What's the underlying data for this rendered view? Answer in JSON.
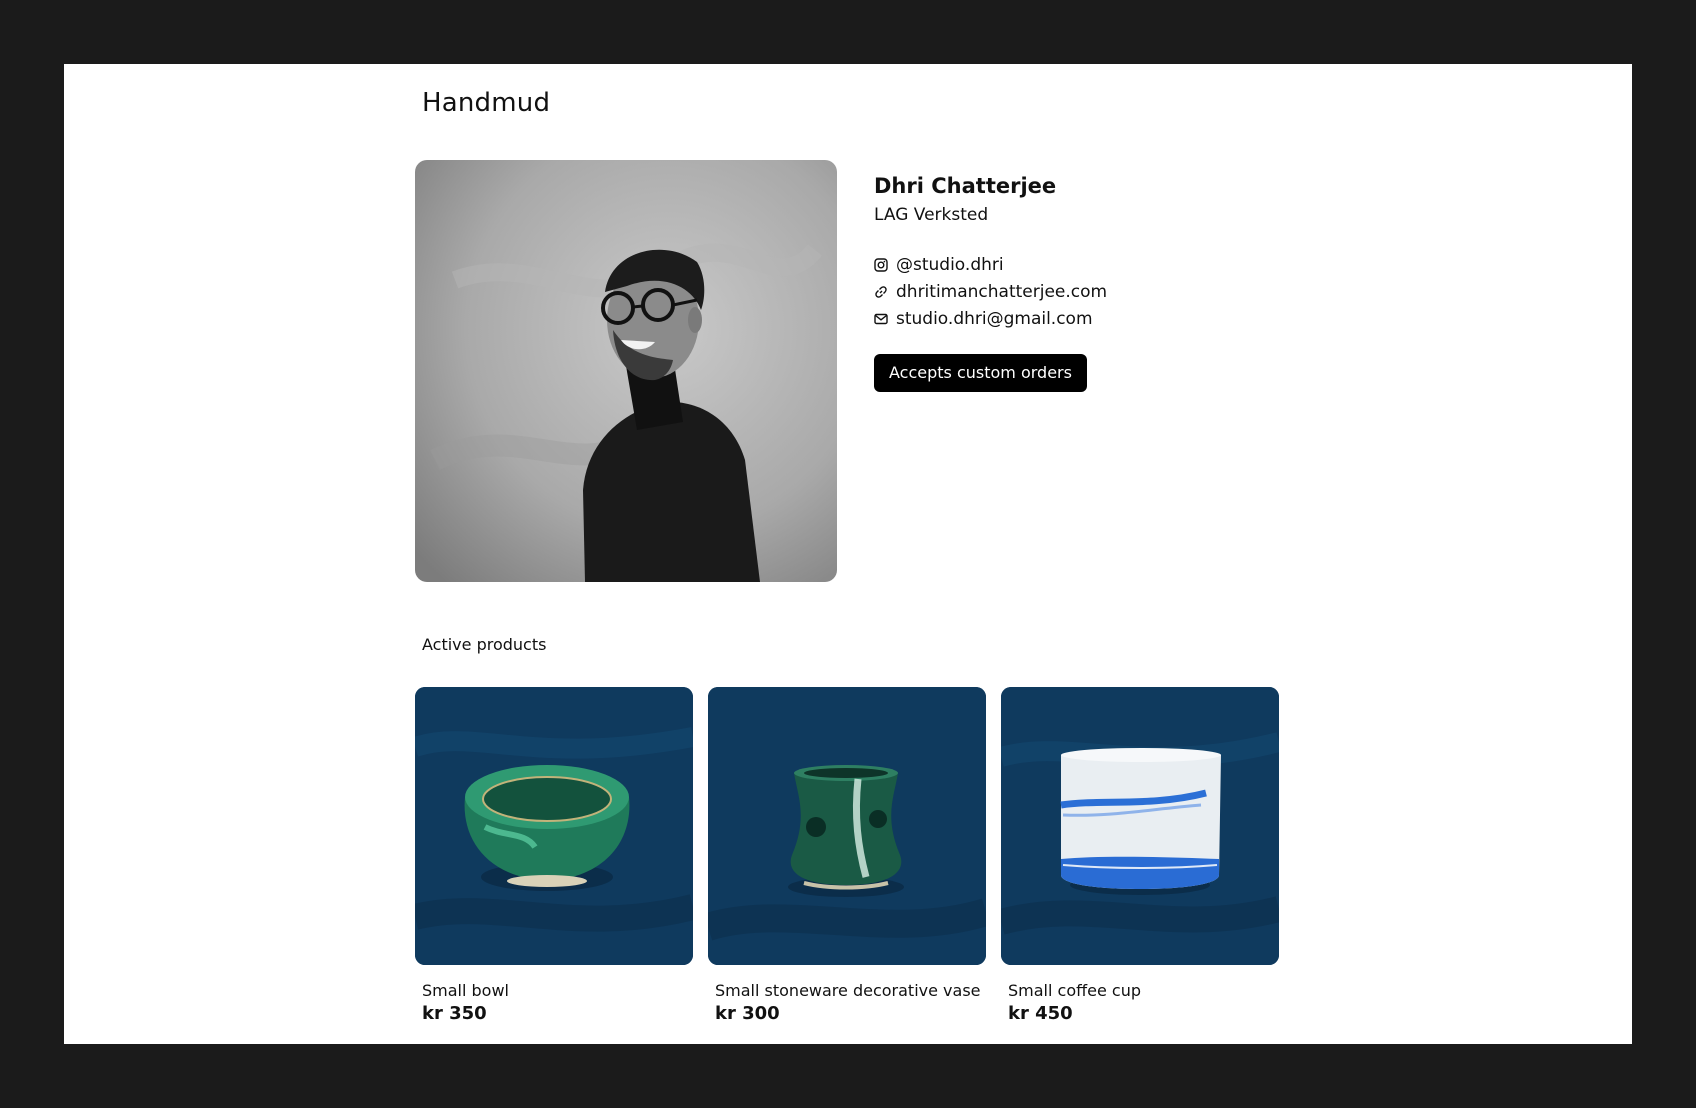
{
  "header": {
    "brand": "Handmud"
  },
  "profile": {
    "name": "Dhri Chatterjee",
    "studio": "LAG Verksted",
    "links": [
      {
        "icon": "instagram-icon",
        "text": "@studio.dhri"
      },
      {
        "icon": "link-icon",
        "text": "dhritimanchatterjee.com"
      },
      {
        "icon": "mail-icon",
        "text": "studio.dhri@gmail.com"
      }
    ],
    "badge": "Accepts custom orders"
  },
  "products": {
    "title": "Active products",
    "items": [
      {
        "title": "Small bowl",
        "price": "kr 350"
      },
      {
        "title": "Small stoneware decorative vase",
        "price": "kr 300"
      },
      {
        "title": "Small coffee cup",
        "price": "kr 450"
      }
    ]
  },
  "colors": {
    "page_background": "#1b1b1b",
    "surface": "#ffffff",
    "badge_background": "#000000",
    "product_backdrop": "#0f3a5e"
  }
}
